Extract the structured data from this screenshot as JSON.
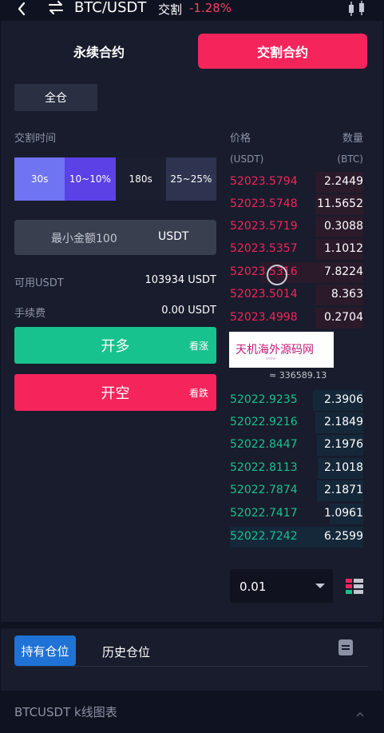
{
  "header": {
    "pair": "BTC/USDT",
    "type": "交割",
    "change": "-1.28%"
  },
  "tabs": {
    "perpetual": "永续合约",
    "delivery": "交割合约"
  },
  "margin_mode": "全仓",
  "delivery_time_label": "交割时间",
  "periods": [
    {
      "duration": "30s",
      "range": "10~10%"
    },
    {
      "duration": "180s",
      "range": "25~25%"
    }
  ],
  "amount": {
    "placeholder": "最小金额100",
    "unit": "USDT"
  },
  "available": {
    "label": "可用USDT",
    "value": "103934 USDT"
  },
  "fee": {
    "label": "手续费",
    "value": "0.00 USDT"
  },
  "buttons": {
    "long": "开多",
    "long_sub": "看涨",
    "short": "开空",
    "short_sub": "看跌"
  },
  "orderbook": {
    "price_header": "价格",
    "qty_header": "数量",
    "price_unit": "(USDT)",
    "qty_unit": "(BTC)",
    "asks": [
      {
        "price": "52023.5794",
        "qty": "2.2449",
        "depth": 0.36
      },
      {
        "price": "52023.5748",
        "qty": "11.5652",
        "depth": 0.36
      },
      {
        "price": "52023.5719",
        "qty": "0.3088",
        "depth": 0.36
      },
      {
        "price": "52023.5357",
        "qty": "1.1012",
        "depth": 0.36
      },
      {
        "price": "52023.5316",
        "qty": "7.8224",
        "depth": 0.77
      },
      {
        "price": "52023.5014",
        "qty": "8.363",
        "depth": 0.36
      },
      {
        "price": "52023.4998",
        "qty": "0.2704",
        "depth": 0.36
      }
    ],
    "mid": "≈ 336589.13",
    "bids": [
      {
        "price": "52022.9235",
        "qty": "2.3906",
        "depth": 0.38
      },
      {
        "price": "52022.9216",
        "qty": "2.1849",
        "depth": 0.36
      },
      {
        "price": "52022.8447",
        "qty": "2.1976",
        "depth": 0.35
      },
      {
        "price": "52022.8113",
        "qty": "2.1018",
        "depth": 0.34
      },
      {
        "price": "52022.7874",
        "qty": "2.1871",
        "depth": 0.35
      },
      {
        "price": "52022.7417",
        "qty": "1.0961",
        "depth": 0.25
      },
      {
        "price": "52022.7242",
        "qty": "6.2599",
        "depth": 1.0
      }
    ]
  },
  "watermark": {
    "text": "天机海外源码网",
    "sub": "www"
  },
  "depth_select": "0.01",
  "positions": {
    "tab_hold": "持有仓位",
    "tab_history": "历史仓位"
  },
  "kline": {
    "title": "BTCUSDT  k线图表"
  },
  "colors": {
    "accent_red": "#f5245b",
    "accent_green": "#18c28f",
    "accent_blue": "#1f72d6",
    "purple": "#5b41e6"
  }
}
